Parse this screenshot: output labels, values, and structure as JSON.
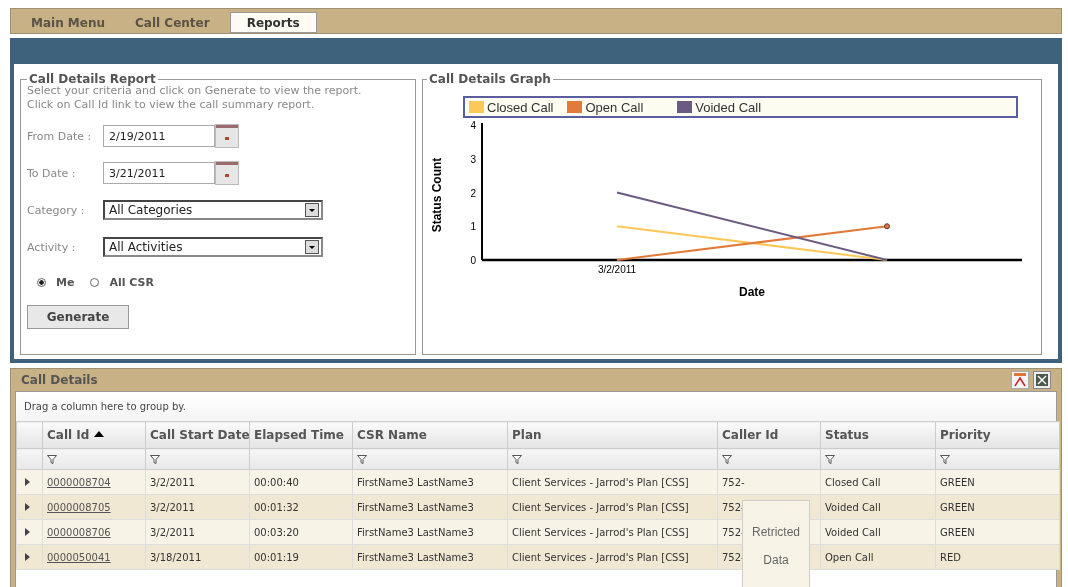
{
  "tabs": [
    {
      "label": "Main Menu",
      "selected": false
    },
    {
      "label": "Call Center",
      "selected": false
    },
    {
      "label": "Reports",
      "selected": true
    }
  ],
  "report_form": {
    "title": "Call Details Report",
    "instructions": [
      "Select your criteria and click on Generate to view the report.",
      "Click on Call Id link to view the call summary report."
    ],
    "fields": [
      {
        "kind": "date",
        "label": "From Date :",
        "value": "2/19/2011"
      },
      {
        "kind": "date",
        "label": "To Date :",
        "value": "3/21/2011"
      },
      {
        "kind": "select",
        "label": "Category :",
        "value": "All Categories"
      },
      {
        "kind": "select",
        "label": "Activity :",
        "value": "All Activities"
      }
    ],
    "scope": [
      {
        "label": "Me",
        "selected": true
      },
      {
        "label": "All CSR",
        "selected": false
      }
    ],
    "button": "Generate"
  },
  "graph": {
    "title": "Call Details Graph",
    "chart_data": {
      "type": "line",
      "xlabel": "Date",
      "ylabel": "Status Count",
      "categories": [
        "3/2/2011",
        null
      ],
      "legend": "top",
      "ylim": [
        0,
        4
      ],
      "yticks": [
        {
          "value": 0,
          "label": "0"
        },
        {
          "value": 1,
          "label": "1"
        },
        {
          "value": 2,
          "label": "2"
        },
        {
          "value": 3,
          "label": "3"
        },
        {
          "value": 4,
          "label": "4"
        }
      ],
      "series": [
        {
          "name": "Closed Call",
          "color": "#fcc85a",
          "values": [
            1,
            0
          ]
        },
        {
          "name": "Open Call",
          "color": "#e07b3c",
          "values": [
            0,
            1
          ]
        },
        {
          "name": "Voided Call",
          "color": "#6b5b80",
          "values": [
            2,
            0
          ]
        }
      ]
    }
  },
  "call_details": {
    "title": "Call Details",
    "group_hint": "Drag a column here to group by.",
    "columns": [
      {
        "label": "Call Id",
        "sorted": true,
        "filter": true
      },
      {
        "label": "Call Start Date",
        "sorted": false,
        "filter": true
      },
      {
        "label": "Elapsed Time",
        "sorted": false,
        "filter": false
      },
      {
        "label": "CSR Name",
        "sorted": false,
        "filter": true
      },
      {
        "label": "Plan",
        "sorted": false,
        "filter": true
      },
      {
        "label": "Caller Id",
        "sorted": false,
        "filter": true
      },
      {
        "label": "Status",
        "sorted": false,
        "filter": true
      },
      {
        "label": "Priority",
        "sorted": false,
        "filter": true
      }
    ],
    "rows": [
      [
        "0000008704",
        "3/2/2011",
        "00:00:40",
        "FirstName3 LastName3",
        "Client Services - Jarrod's Plan [CSS]",
        "752-",
        "Closed Call",
        "GREEN"
      ],
      [
        "0000008705",
        "3/2/2011",
        "00:01:32",
        "FirstName3 LastName3",
        "Client Services - Jarrod's Plan [CSS]",
        "752-",
        "Voided Call",
        "GREEN"
      ],
      [
        "0000008706",
        "3/2/2011",
        "00:03:20",
        "FirstName3 LastName3",
        "Client Services - Jarrod's Plan [CSS]",
        "752-",
        "Voided Call",
        "GREEN"
      ],
      [
        "0000050041",
        "3/18/2011",
        "00:01:19",
        "FirstName3 LastName3",
        "Client Services - Jarrod's Plan [CSS]",
        "752-",
        "Open Call",
        "RED"
      ]
    ],
    "tooltip": [
      "Retricted",
      "Data"
    ]
  }
}
